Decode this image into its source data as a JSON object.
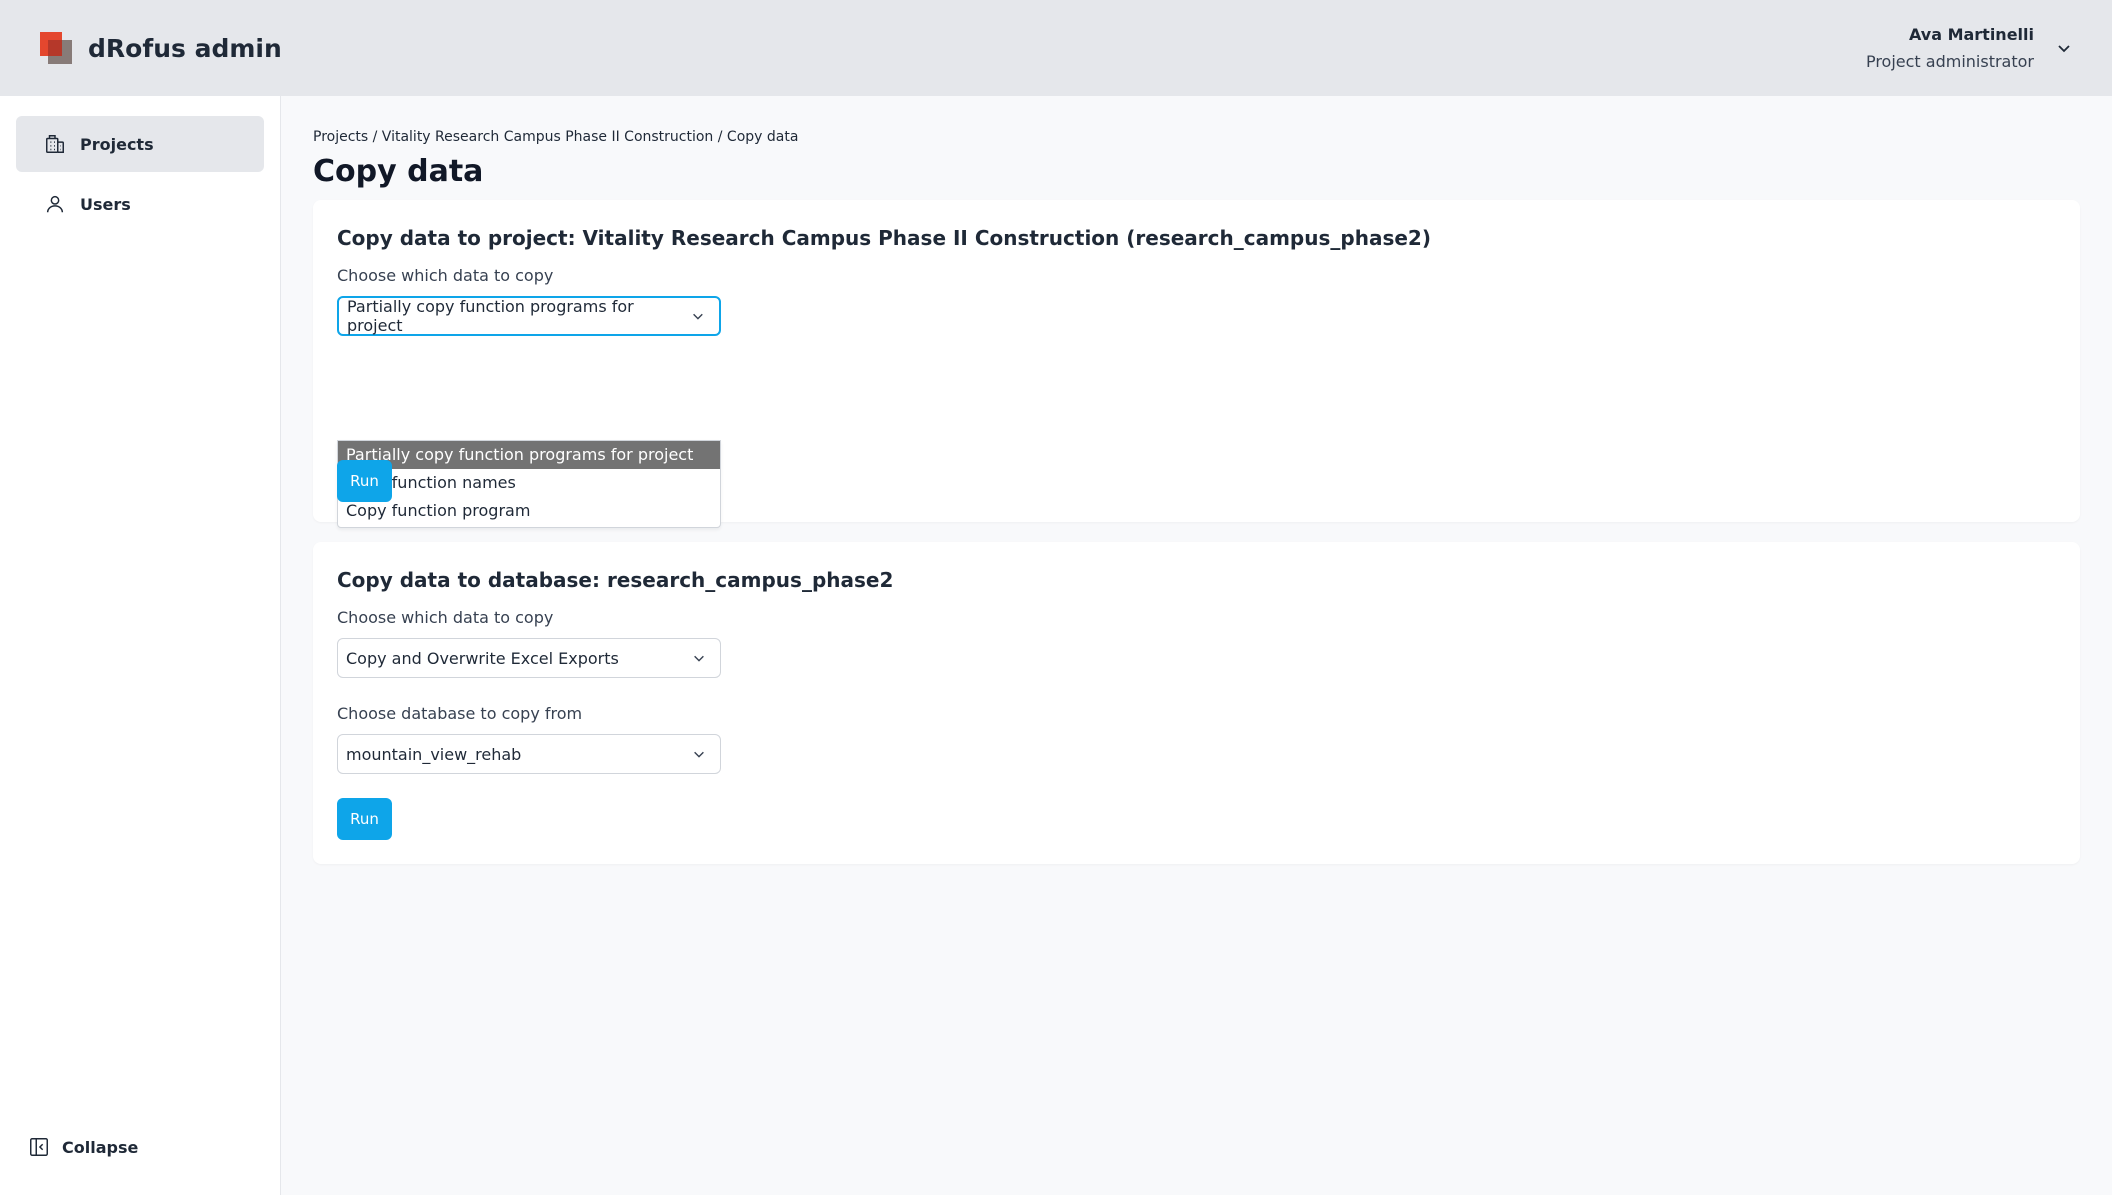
{
  "header": {
    "brand": "dRofus admin",
    "user_name": "Ava Martinelli",
    "user_role": "Project administrator"
  },
  "sidebar": {
    "items": [
      {
        "label": "Projects",
        "icon": "building-icon",
        "active": true
      },
      {
        "label": "Users",
        "icon": "user-icon",
        "active": false
      }
    ],
    "collapse_label": "Collapse"
  },
  "breadcrumb": "Projects / Vitality Research Campus Phase II Construction / Copy data",
  "page_title": "Copy data",
  "project_card": {
    "title": "Copy data to project: Vitality Research Campus Phase II Construction (research_campus_phase2)",
    "data_label": "Choose which data to copy",
    "data_selected": "Partially copy function programs for project",
    "options": [
      "Partially copy function programs for project",
      "Copy function names",
      "Copy function program"
    ],
    "run_label": "Run"
  },
  "database_card": {
    "title": "Copy data to database: research_campus_phase2",
    "data_label": "Choose which data to copy",
    "data_selected": "Copy and Overwrite Excel Exports",
    "source_label": "Choose database to copy from",
    "source_selected": "mountain_view_rehab",
    "run_label": "Run"
  },
  "colors": {
    "accent": "#0ea5e9",
    "brand_red": "#e4472e",
    "header_bg": "#e5e7eb"
  }
}
